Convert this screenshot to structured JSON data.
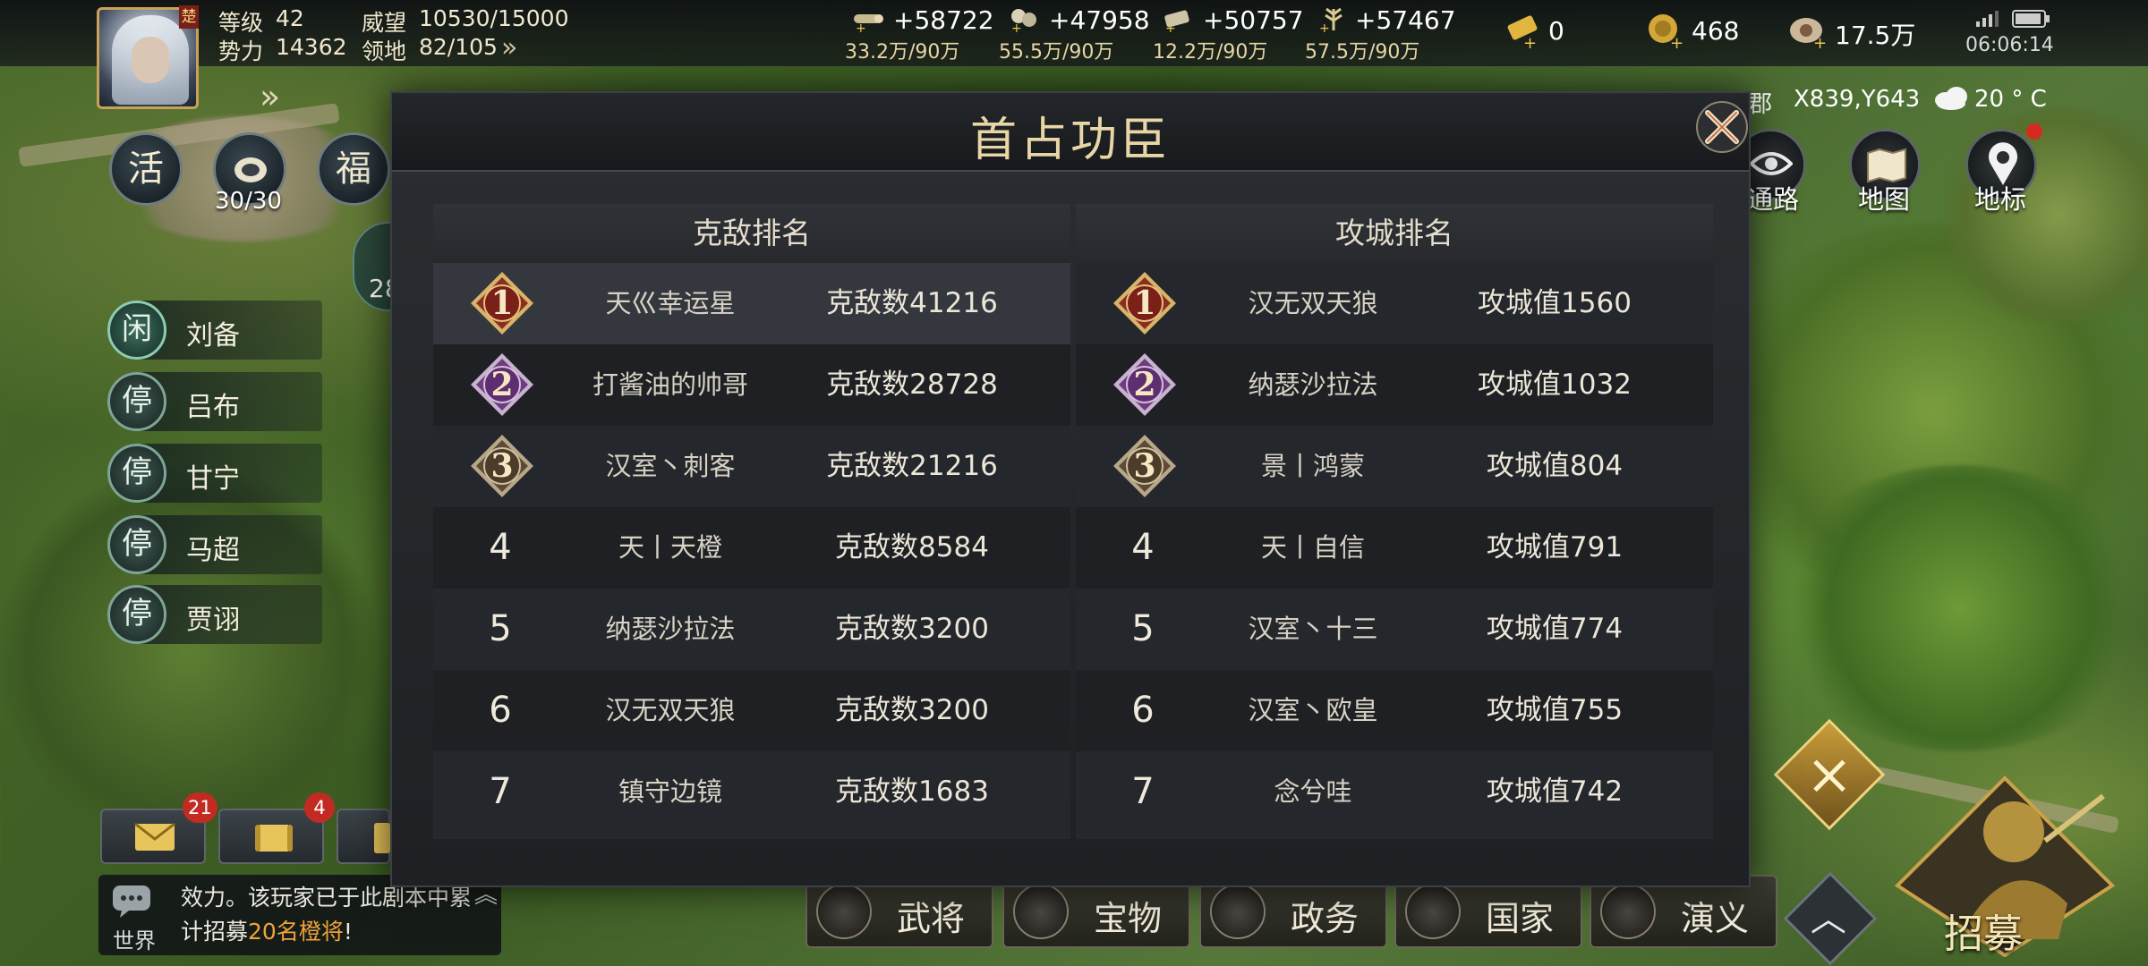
{
  "player": {
    "faction_char": "楚",
    "level_label": "等级",
    "level": "42",
    "power_label": "势力",
    "power": "14362",
    "prestige_label": "威望",
    "prestige": "10530/15000",
    "territory_label": "领地",
    "territory": "82/105"
  },
  "resources": [
    {
      "icon": "wood-icon",
      "rate": "+58722",
      "stock": "33.2万/90万"
    },
    {
      "icon": "iron-icon",
      "rate": "+47958",
      "stock": "55.5万/90万"
    },
    {
      "icon": "stone-icon",
      "rate": "+50757",
      "stock": "12.2万/90万"
    },
    {
      "icon": "grain-icon",
      "rate": "+57467",
      "stock": "57.5万/90万"
    }
  ],
  "currency": {
    "gold_bar": "0",
    "copper": "468",
    "coin": "17.5万"
  },
  "status_bar": {
    "time": "06:06:14"
  },
  "left_buttons": [
    {
      "label": "活"
    },
    {
      "label": "",
      "sub": "30/30"
    },
    {
      "label": "福"
    }
  ],
  "partial_side_number": "28",
  "heroes": [
    {
      "status": "闲",
      "name": "刘备"
    },
    {
      "status": "停",
      "name": "吕布"
    },
    {
      "status": "停",
      "name": "甘宁"
    },
    {
      "status": "停",
      "name": "马超"
    },
    {
      "status": "停",
      "name": "贾诩"
    }
  ],
  "mail": {
    "badge": "21"
  },
  "bulletin": {
    "badge": "4"
  },
  "chat": {
    "channel": "世界",
    "line1": "效力。该玩家已于此剧本中累",
    "line2_prefix": "计招募",
    "line2_highlight": "20名橙将",
    "line2_suffix": "!"
  },
  "location": {
    "region_partial": "郡",
    "coords": "X839,Y643",
    "weather": "20 ° C"
  },
  "map_buttons": [
    {
      "icon": "eye-icon",
      "label": "通路"
    },
    {
      "icon": "map-icon",
      "label": "地图"
    },
    {
      "icon": "marker-icon",
      "label": "地标"
    }
  ],
  "bottom_nav": [
    {
      "icon": "general-icon",
      "label": "武将"
    },
    {
      "icon": "treasure-icon",
      "label": "宝物"
    },
    {
      "icon": "policy-icon",
      "label": "政务"
    },
    {
      "icon": "nation-icon",
      "label": "国家"
    },
    {
      "icon": "saga-icon",
      "label": "演义"
    }
  ],
  "recruit_label": "招募",
  "modal": {
    "title": "首占功臣",
    "left": {
      "header": "克敌排名",
      "rows": [
        {
          "rank": "1",
          "name": "天巛幸运星",
          "value": "克敌数41216"
        },
        {
          "rank": "2",
          "name": "打酱油的帅哥",
          "value": "克敌数28728"
        },
        {
          "rank": "3",
          "name": "汉室丶刺客",
          "value": "克敌数21216"
        },
        {
          "rank": "4",
          "name": "天丨天橙",
          "value": "克敌数8584"
        },
        {
          "rank": "5",
          "name": "纳瑟沙拉法",
          "value": "克敌数3200"
        },
        {
          "rank": "6",
          "name": "汉无双天狼",
          "value": "克敌数3200"
        },
        {
          "rank": "7",
          "name": "镇守边镜",
          "value": "克敌数1683"
        }
      ]
    },
    "right": {
      "header": "攻城排名",
      "rows": [
        {
          "rank": "1",
          "name": "汉无双天狼",
          "value": "攻城值1560"
        },
        {
          "rank": "2",
          "name": "纳瑟沙拉法",
          "value": "攻城值1032"
        },
        {
          "rank": "3",
          "name": "景丨鸿蒙",
          "value": "攻城值804"
        },
        {
          "rank": "4",
          "name": "天丨自信",
          "value": "攻城值791"
        },
        {
          "rank": "5",
          "name": "汉室丶十三",
          "value": "攻城值774"
        },
        {
          "rank": "6",
          "name": "汉室丶欧皇",
          "value": "攻城值755"
        },
        {
          "rank": "7",
          "name": "念兮哇",
          "value": "攻城值742"
        }
      ]
    }
  },
  "colors": {
    "gold": "#e8d6a6",
    "rank1": "#8a2d22",
    "rank2": "#6e3c7f",
    "rank3": "#5b4a35",
    "badge_red": "#c22a22",
    "highlight_orange": "#f0a33a"
  }
}
